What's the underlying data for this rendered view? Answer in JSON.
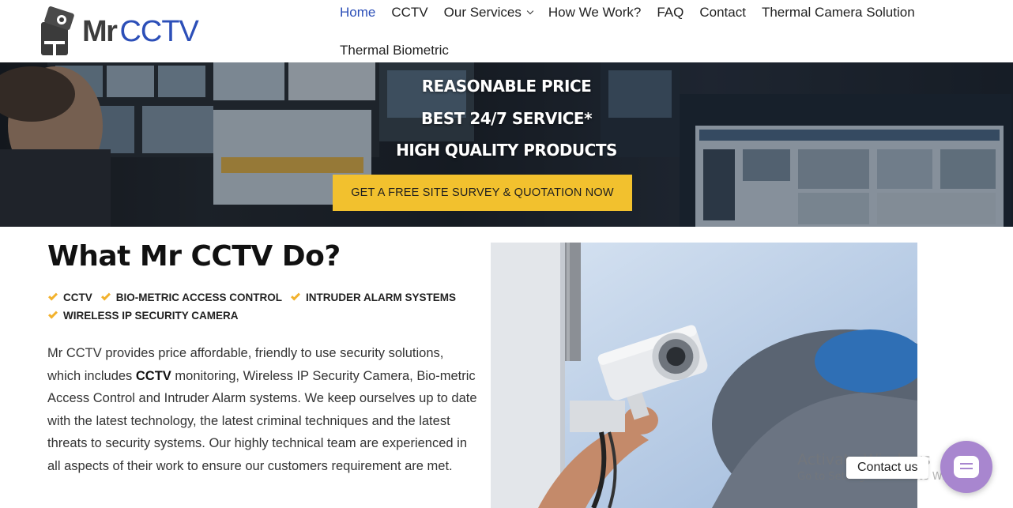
{
  "brand": {
    "logo_part1": "Mr",
    "logo_part2": "CCTV",
    "accent_color": "#2c4fb8"
  },
  "nav": {
    "items": [
      {
        "label": "Home",
        "active": true
      },
      {
        "label": "CCTV"
      },
      {
        "label": "Our Services",
        "has_dropdown": true
      },
      {
        "label": "How We Work?"
      },
      {
        "label": "FAQ"
      },
      {
        "label": "Contact"
      },
      {
        "label": "Thermal Camera Solution"
      },
      {
        "label": "Thermal Biometric"
      }
    ]
  },
  "hero": {
    "line1": "REASONABLE PRICE",
    "line2": "BEST 24/7 SERVICE*",
    "line3": "HIGH QUALITY PRODUCTS",
    "cta_label": "GET A FREE SITE SURVEY & QUOTATION NOW",
    "cta_color": "#f2c12e"
  },
  "about": {
    "title": "What Mr CCTV Do?",
    "services": [
      "CCTV",
      "BIO-METRIC ACCESS CONTROL",
      "INTRUDER ALARM SYSTEMS",
      "WIRELESS IP SECURITY CAMERA"
    ],
    "check_color": "#f2b22e",
    "para_before": "Mr CCTV provides price affordable, friendly to use security solutions, which includes ",
    "para_bold": "CCTV",
    "para_after": " monitoring, Wireless IP Security Camera, Bio-metric Access Control and Intruder Alarm systems. We keep ourselves up to date with the latest technology, the latest criminal techniques and the latest threats to security systems. Our highly technical team are experienced in all aspects of their work to ensure our customers requirement are met."
  },
  "watermark": {
    "line1": "Activate Windows",
    "line2": "Go to Settings to activate Windows."
  },
  "contact_widget": {
    "label": "Contact us",
    "color": "#a886cf",
    "icon": "chat-icon"
  }
}
